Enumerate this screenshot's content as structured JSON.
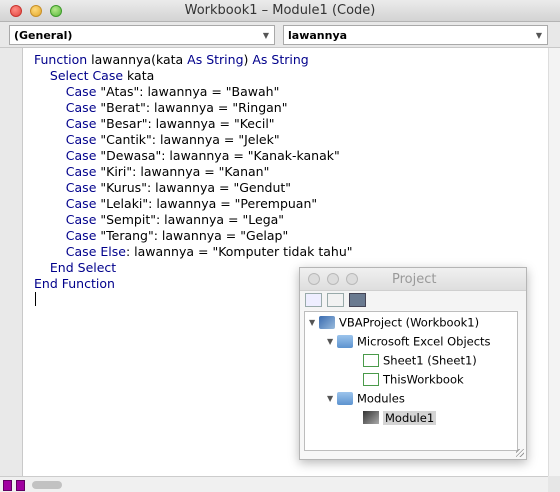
{
  "window": {
    "title": "Workbook1 – Module1 (Code)"
  },
  "dropdowns": {
    "object": "(General)",
    "procedure": "lawannya"
  },
  "code_lines": [
    [
      {
        "t": "Function ",
        "k": true
      },
      {
        "t": "lawannya(kata "
      },
      {
        "t": "As String",
        "k": true
      },
      {
        "t": ") "
      },
      {
        "t": "As String",
        "k": true
      }
    ],
    [
      {
        "t": "    "
      },
      {
        "t": "Select Case ",
        "k": true
      },
      {
        "t": "kata"
      }
    ],
    [
      {
        "t": "        "
      },
      {
        "t": "Case ",
        "k": true
      },
      {
        "t": "\"Atas\": lawannya = \"Bawah\""
      }
    ],
    [
      {
        "t": "        "
      },
      {
        "t": "Case ",
        "k": true
      },
      {
        "t": "\"Berat\": lawannya = \"Ringan\""
      }
    ],
    [
      {
        "t": "        "
      },
      {
        "t": "Case ",
        "k": true
      },
      {
        "t": "\"Besar\": lawannya = \"Kecil\""
      }
    ],
    [
      {
        "t": "        "
      },
      {
        "t": "Case ",
        "k": true
      },
      {
        "t": "\"Cantik\": lawannya = \"Jelek\""
      }
    ],
    [
      {
        "t": "        "
      },
      {
        "t": "Case ",
        "k": true
      },
      {
        "t": "\"Dewasa\": lawannya = \"Kanak-kanak\""
      }
    ],
    [
      {
        "t": "        "
      },
      {
        "t": "Case ",
        "k": true
      },
      {
        "t": "\"Kiri\": lawannya = \"Kanan\""
      }
    ],
    [
      {
        "t": "        "
      },
      {
        "t": "Case ",
        "k": true
      },
      {
        "t": "\"Kurus\": lawannya = \"Gendut\""
      }
    ],
    [
      {
        "t": "        "
      },
      {
        "t": "Case ",
        "k": true
      },
      {
        "t": "\"Lelaki\": lawannya = \"Perempuan\""
      }
    ],
    [
      {
        "t": "        "
      },
      {
        "t": "Case ",
        "k": true
      },
      {
        "t": "\"Sempit\": lawannya = \"Lega\""
      }
    ],
    [
      {
        "t": "        "
      },
      {
        "t": "Case ",
        "k": true
      },
      {
        "t": "\"Terang\": lawannya = \"Gelap\""
      }
    ],
    [
      {
        "t": "        "
      },
      {
        "t": "Case Else",
        "k": true
      },
      {
        "t": ": lawannya = \"Komputer tidak tahu\""
      }
    ],
    [
      {
        "t": "    "
      },
      {
        "t": "End Select",
        "k": true
      }
    ],
    [
      {
        "t": "End Function",
        "k": true
      }
    ]
  ],
  "project": {
    "title": "Project",
    "tree": {
      "root": "VBAProject (Workbook1)",
      "excel_folder": "Microsoft Excel Objects",
      "sheet1": "Sheet1 (Sheet1)",
      "thisworkbook": "ThisWorkbook",
      "modules_folder": "Modules",
      "module1": "Module1"
    }
  },
  "icons": {
    "close": "close-icon",
    "minimize": "minimize-icon",
    "zoom": "zoom-icon",
    "dropdown": "chevron-down-icon",
    "project": "vba-project-icon",
    "folder": "folder-icon",
    "sheet": "sheet-icon",
    "module": "module-icon"
  },
  "colors": {
    "keyword": "#00008b",
    "selection": "#d4d4d4"
  }
}
